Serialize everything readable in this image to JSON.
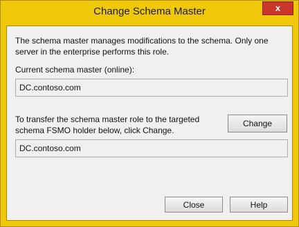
{
  "window": {
    "title": "Change Schema Master",
    "close_glyph": "x"
  },
  "dialog": {
    "description": "The schema master manages modifications to the schema. Only one server in the enterprise performs this role.",
    "current_label": "Current schema master (online):",
    "current_value": "DC.contoso.com",
    "transfer_text": "To transfer the schema master role to the targeted schema FSMO holder below, click Change.",
    "change_label": "Change",
    "target_value": "DC.contoso.com",
    "close_label": "Close",
    "help_label": "Help"
  }
}
